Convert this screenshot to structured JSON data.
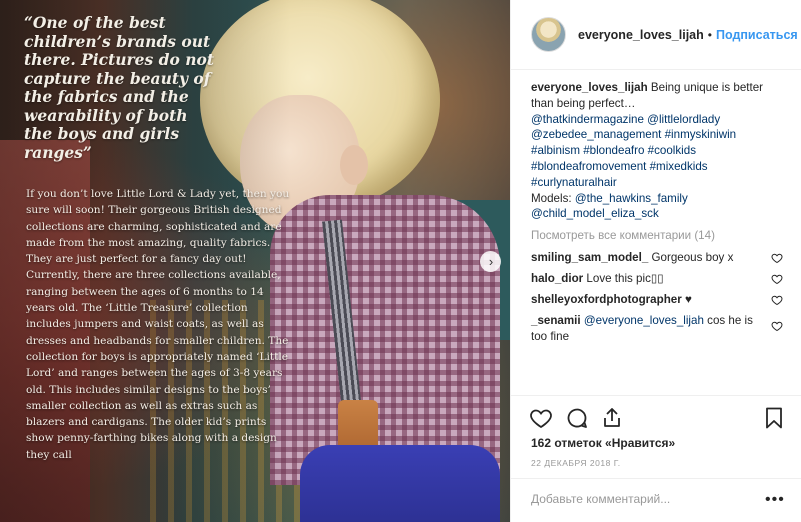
{
  "photo": {
    "quote": "“One of the best children’s brands out there. Pictures do not capture the beauty of the fabrics and the wearability of both the boys and girls ranges”",
    "article": [
      "If you don’t love Little Lord & Lady yet, then you sure will soon! Their gorgeous British designed collections are charming, sophisticated and are made from the most amazing, quality fabrics. They are just perfect for a fancy day out!",
      "Currently, there are three collections available, ranging between the ages of 6 months to 14 years old. The ‘Little Treasure’ collection includes jumpers and waist coats, as well as dresses and headbands for smaller children. The collection for boys is appropriately named ‘Little Lord’ and ranges between the ages of 3-8 years old. This includes similar designs to the boys’ smaller collection as well as extras such as blazers and cardigans. The older kid’s prints show penny-farthing bikes along with a design they call"
    ],
    "next_icon": "chevron-right-icon"
  },
  "header": {
    "username": "everyone_loves_lijah",
    "separator": "•",
    "follow_label": "Подписаться"
  },
  "caption": {
    "username": "everyone_loves_lijah",
    "text": "Being unique is better than being perfect…",
    "tags_line1": "@thatkindermagazine @littlelordlady",
    "tags_line2": "@zebedee_management #inmyskiniwin",
    "tags_line3": "#albinism #blondeafro #coolkids",
    "tags_line4": "#blondeafromovement #mixedkids",
    "tags_line5": "#curlynaturalhair",
    "models_label": "Models:",
    "models_line1": "@the_hawkins_family",
    "models_line2": "@child_model_eliza_sck"
  },
  "view_all_comments": "Посмотреть все комментарии (14)",
  "comments": [
    {
      "user": "smiling_sam_model_",
      "text": "Gorgeous boy x"
    },
    {
      "user": "halo_dior",
      "text": "Love this pic▯▯"
    },
    {
      "user": "shelleyoxfordphotographer",
      "text": "♥"
    },
    {
      "user": "_senamii",
      "mention": "@everyone_loves_lijah",
      "text": "cos he is too fine"
    }
  ],
  "actions": {
    "like_icon": "heart-icon",
    "comment_icon": "comment-icon",
    "share_icon": "share-icon",
    "save_icon": "bookmark-icon"
  },
  "likes_text": "162 отметок «Нравится»",
  "date": "22 ДЕКАБРЯ 2018 Г.",
  "add_comment": {
    "placeholder": "Добавьте комментарий...",
    "more_label": "•••"
  },
  "colors": {
    "link_blue": "#003569",
    "follow_blue": "#3897f0",
    "muted": "#999999"
  }
}
